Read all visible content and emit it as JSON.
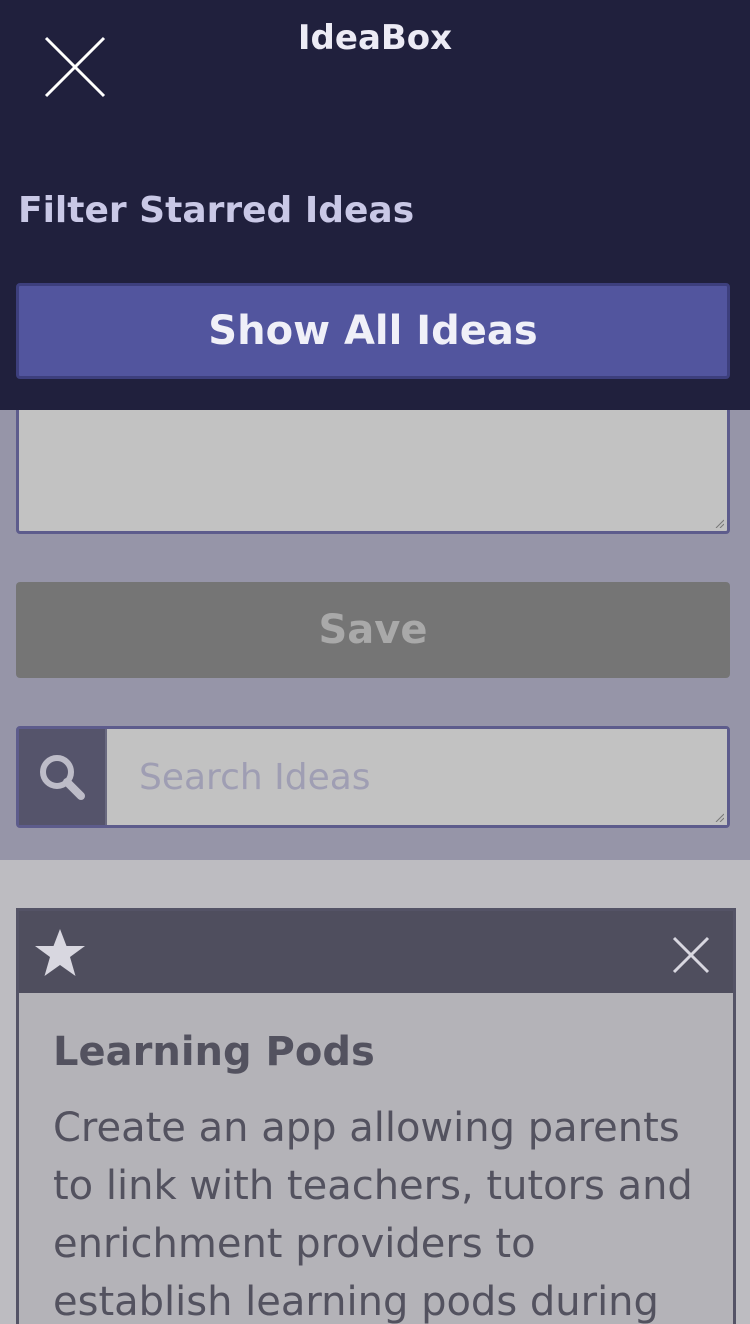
{
  "header": {
    "title": "IdeaBox",
    "filter_label": "Filter Starred Ideas",
    "show_all_label": "Show All Ideas"
  },
  "form": {
    "save_label": "Save",
    "search_placeholder": "Search Ideas"
  },
  "idea": {
    "title": "Learning Pods",
    "body": "Create an app allowing parents to link with teachers, tutors and enrichment providers to establish learning pods during"
  },
  "icons": {
    "close": "close-icon",
    "search": "search-icon",
    "star": "star-icon",
    "delete": "close-icon"
  },
  "colors": {
    "overlay_bg": "#20203d",
    "accent": "#52559e",
    "dimmed_form_bg": "#9695a8",
    "save_disabled": "#757575",
    "card_header": "#4f4e5e"
  }
}
